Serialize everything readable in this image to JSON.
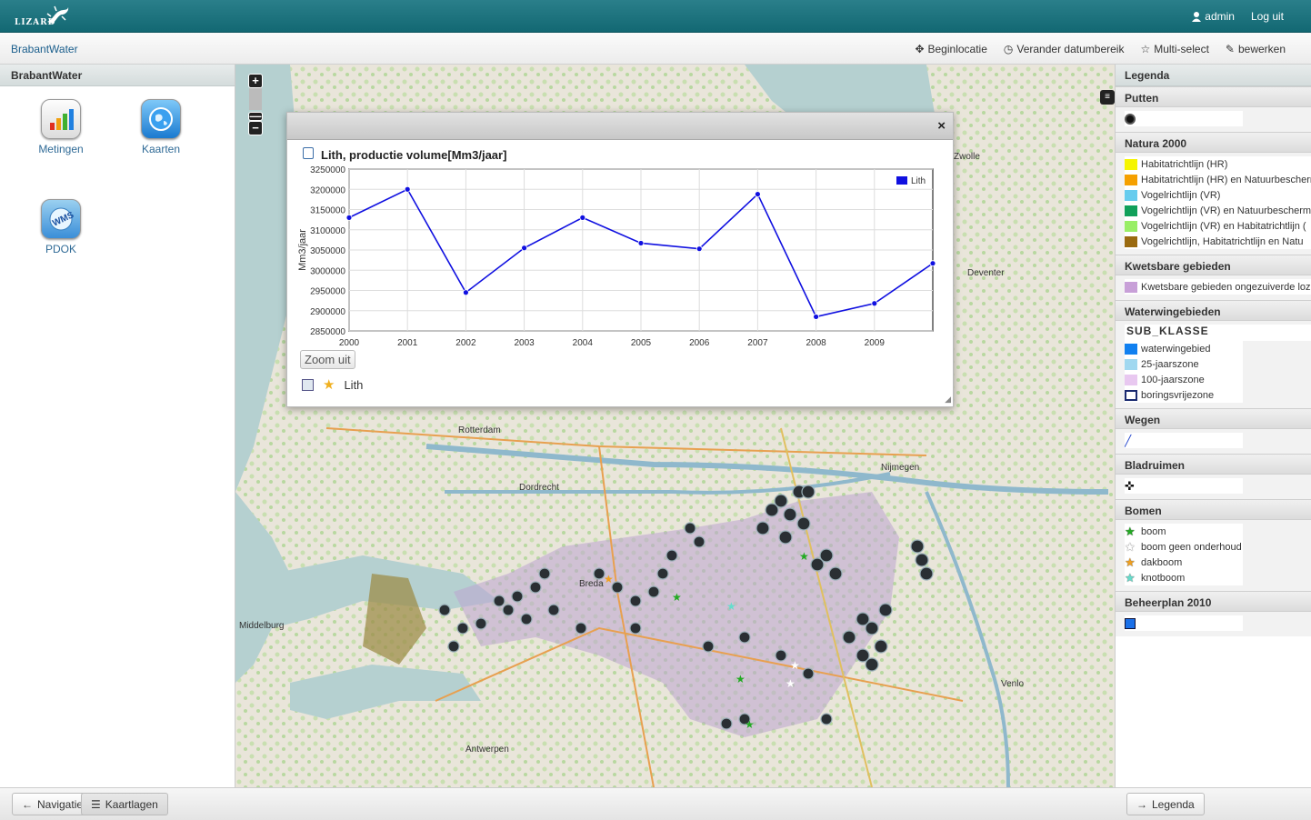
{
  "topbar": {
    "logo_text": "LIZARD",
    "user": "admin",
    "logout": "Log uit"
  },
  "subbar": {
    "breadcrumb": "BrabantWater",
    "tools": [
      "Beginlocatie",
      "Verander datumbereik",
      "Multi-select",
      "bewerken"
    ]
  },
  "leftpanel": {
    "title": "BrabantWater",
    "apps": [
      {
        "label": "Metingen",
        "icon": "bar-chart-icon"
      },
      {
        "label": "Kaarten",
        "icon": "globe-icon"
      },
      {
        "label": "PDOK",
        "icon": "wms-icon"
      }
    ]
  },
  "popup": {
    "close": "×",
    "title": "Lith, productie volume[Mm3/jaar]",
    "zoom_out": "Zoom uit",
    "footer_label": "Lith"
  },
  "chart_data": {
    "type": "line",
    "title": "Lith, productie volume[Mm3/jaar]",
    "xlabel": "",
    "ylabel": "Mm3/jaar",
    "x": [
      2000,
      2001,
      2002,
      2003,
      2004,
      2005,
      2006,
      2007,
      2008,
      2009,
      2010
    ],
    "x_tick_labels": [
      "2000",
      "2001",
      "2002",
      "2003",
      "2004",
      "2005",
      "2006",
      "2007",
      "2008",
      "2009"
    ],
    "y_tick_labels": [
      "3250000",
      "3200000",
      "3150000",
      "3100000",
      "3050000",
      "3000000",
      "2950000",
      "2900000",
      "2850000"
    ],
    "ylim": [
      2850000,
      3250000
    ],
    "xlim": [
      2000,
      2010
    ],
    "grid": true,
    "legend_position": "top-right",
    "series": [
      {
        "name": "Lith",
        "color": "#1010e0",
        "values": [
          3130000,
          3200000,
          2945000,
          3055000,
          3130000,
          3067000,
          3053000,
          3188000,
          2885000,
          2918000,
          3017000
        ]
      }
    ]
  },
  "map_labels": [
    "Rotterdam",
    "Dordrecht",
    "Middelburg",
    "Antwerpen",
    "Nijmegen",
    "Deventer",
    "Venlo",
    "Zwolle",
    "Breda"
  ],
  "legend": {
    "title": "Legenda",
    "groups": [
      {
        "title": "Putten",
        "items": [
          {
            "label": "",
            "color": "#111111",
            "shape": "circle"
          }
        ]
      },
      {
        "title": "Natura 2000",
        "items": [
          {
            "label": "Habitatrichtlijn (HR)",
            "color": "#f5f500"
          },
          {
            "label": "Habitatrichtlijn (HR) en Natuurbescherm",
            "color": "#f5a000"
          },
          {
            "label": "Vogelrichtlijn (VR)",
            "color": "#66ccee"
          },
          {
            "label": "Vogelrichtlijn (VR) en Natuurbescherm",
            "color": "#11a05a"
          },
          {
            "label": "Vogelrichtlijn (VR) en Habitatrichtlijn (",
            "color": "#99ee66"
          },
          {
            "label": "Vogelrichtlijn, Habitatrichtlijn en Natu",
            "color": "#9a6a10"
          }
        ]
      },
      {
        "title": "Kwetsbare gebieden",
        "items": [
          {
            "label": "Kwetsbare gebieden ongezuiverde lozing",
            "color": "#c8a0d8"
          }
        ]
      },
      {
        "title": "Waterwingebieden",
        "subtitle": "SUB_KLASSE",
        "items": [
          {
            "label": "waterwingebied",
            "color": "#1080f0"
          },
          {
            "label": "25-jaarszone",
            "color": "#a0d8f0"
          },
          {
            "label": "100-jaarszone",
            "color": "#e8c8f0"
          },
          {
            "label": "boringsvrijezone",
            "color": "#ffffff"
          }
        ]
      },
      {
        "title": "Wegen",
        "items": [
          {
            "label": "",
            "color": "#2244cc",
            "shape": "line"
          }
        ]
      },
      {
        "title": "Bladruimen",
        "items": [
          {
            "label": "",
            "color": "#111111",
            "shape": "cross"
          }
        ]
      },
      {
        "title": "Bomen",
        "items": [
          {
            "label": "boom",
            "color": "#22aa22",
            "shape": "star"
          },
          {
            "label": "boom geen onderhoud",
            "color": "#ffffff",
            "shape": "star"
          },
          {
            "label": "dakboom",
            "color": "#f0a020",
            "shape": "star"
          },
          {
            "label": "knotboom",
            "color": "#66ddcc",
            "shape": "star"
          }
        ]
      },
      {
        "title": "Beheerplan 2010",
        "items": [
          {
            "label": "",
            "color": "#1a70e8",
            "shape": "square"
          }
        ]
      }
    ]
  },
  "bottombar": {
    "nav": "Navigatie",
    "layers": "Kaartlagen",
    "legend": "Legenda"
  }
}
